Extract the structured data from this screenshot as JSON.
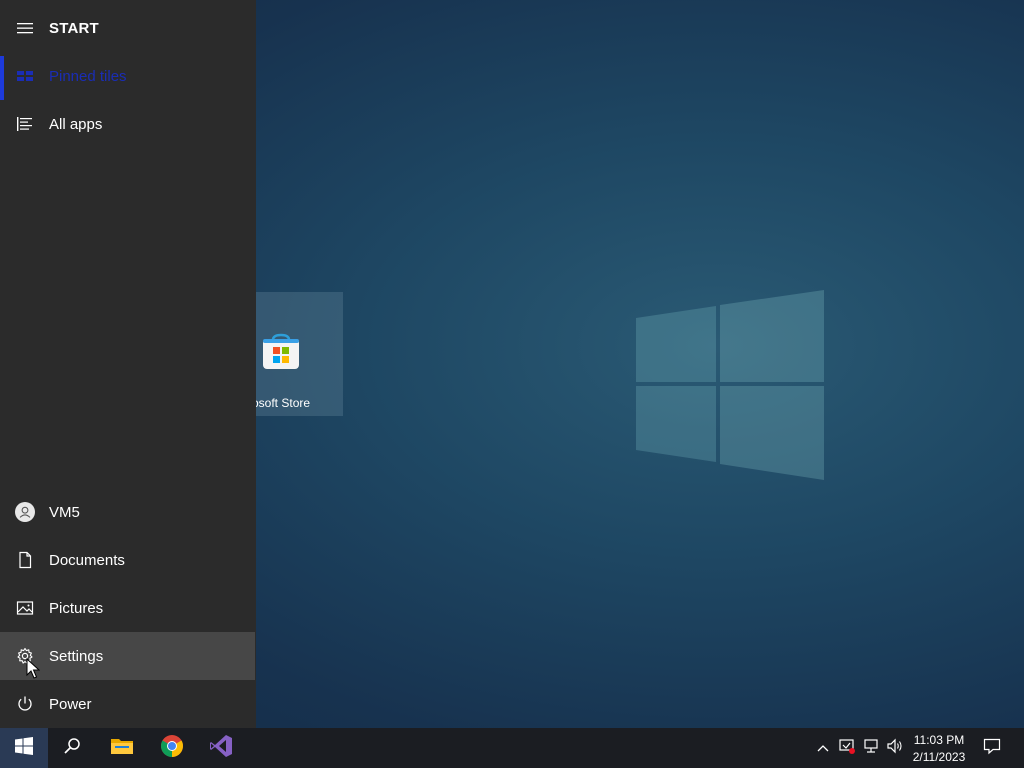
{
  "start_menu": {
    "header_label": "START",
    "items": {
      "pinned_tiles": "Pinned tiles",
      "all_apps": "All apps",
      "user": "VM5",
      "documents": "Documents",
      "pictures": "Pictures",
      "settings": "Settings",
      "power": "Power"
    },
    "accent_color": "#1d3adb",
    "hover_color": "#474747",
    "background_color": "#2b2b2b"
  },
  "tiles": [
    {
      "label": "Microsoft Store",
      "visible_label": "osoft Store",
      "icon": "microsoft-store-icon"
    }
  ],
  "taskbar": {
    "apps": [
      "start-icon",
      "search-icon",
      "file-explorer-icon",
      "chrome-icon",
      "visual-studio-icon"
    ],
    "tray_icons": [
      "chevron-up-icon",
      "defender-icon",
      "network-icon",
      "volume-icon",
      "notification-icon"
    ],
    "clock": {
      "time": "11:03 PM",
      "date": "2/11/2023"
    }
  }
}
